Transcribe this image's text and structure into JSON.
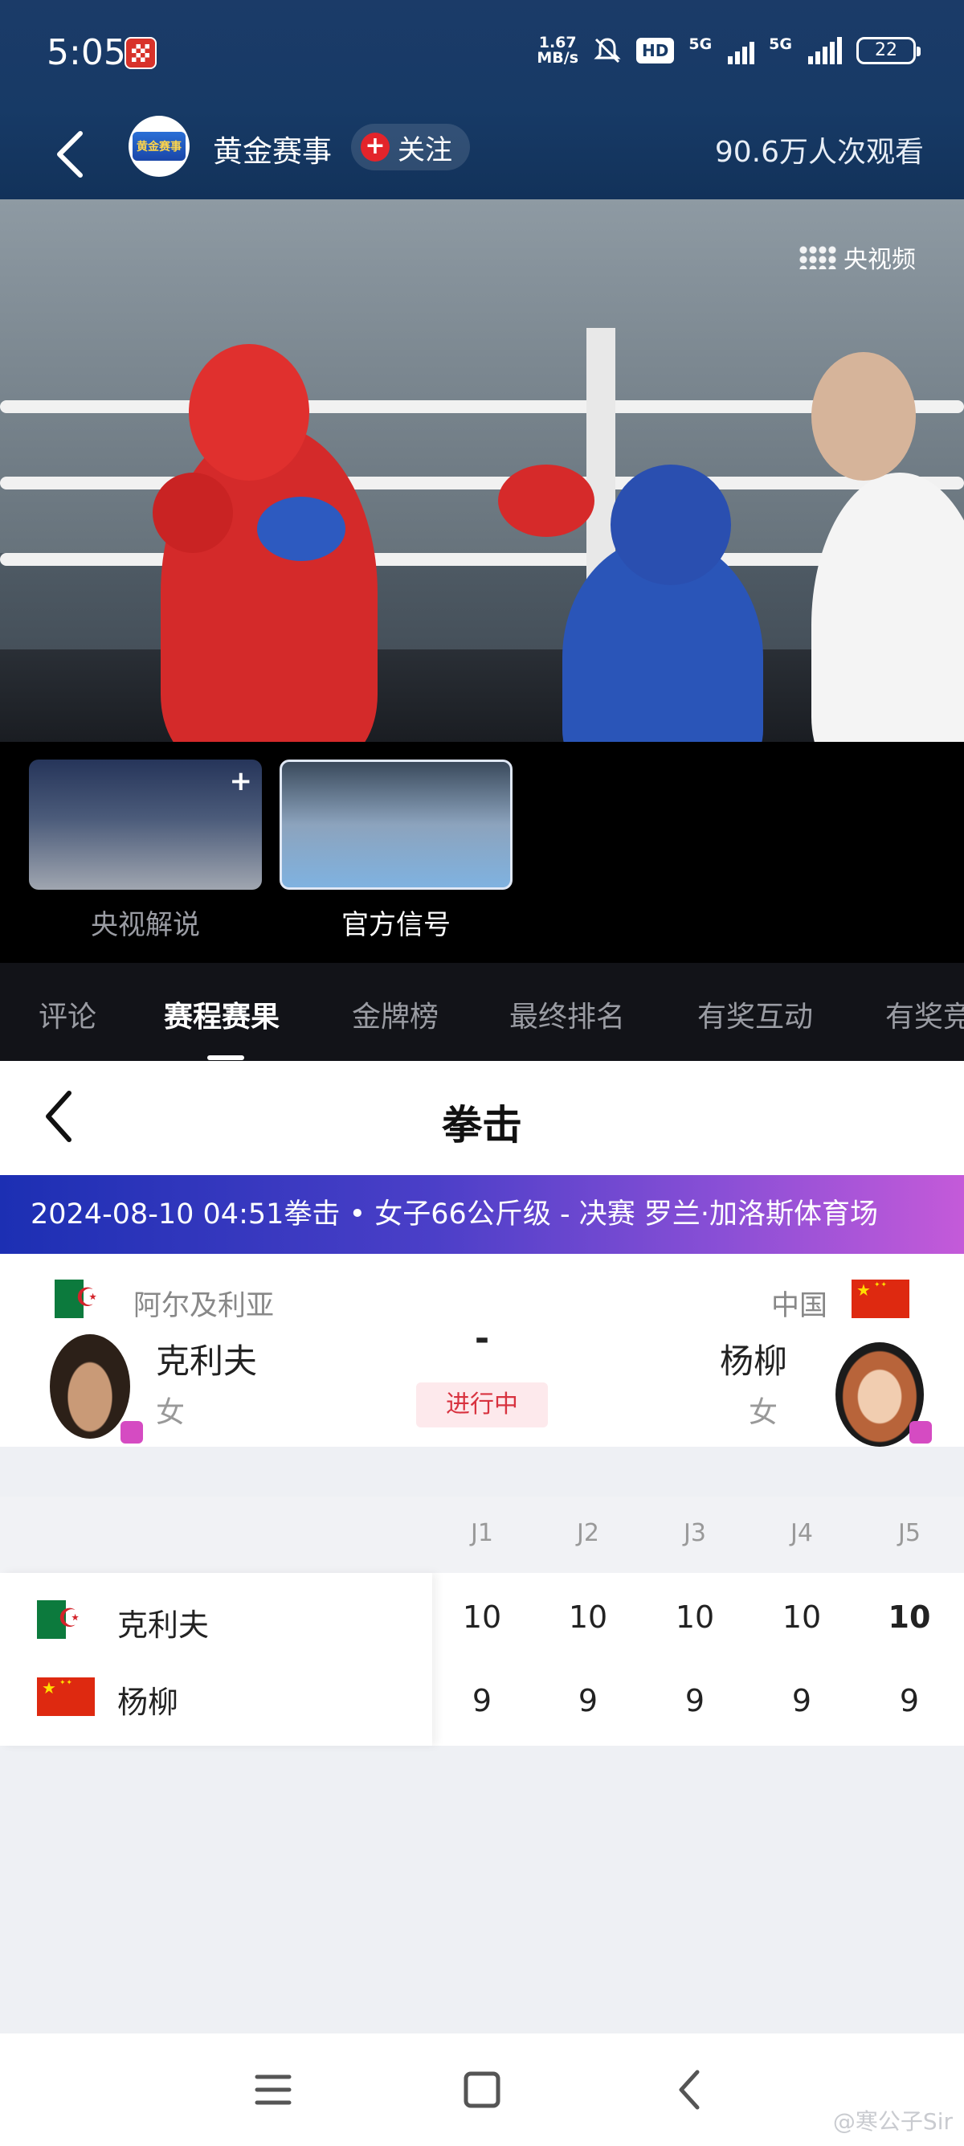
{
  "status_bar": {
    "time": "5:05",
    "net_speed_value": "1.67",
    "net_speed_unit": "MB/s",
    "hd_label": "HD",
    "sim1_label": "5G",
    "sim2_label": "5G",
    "battery": "22"
  },
  "header": {
    "channel_logo_text": "黄金赛事",
    "channel_name": "黄金赛事",
    "follow_label": "关注",
    "viewers": "90.6万人次观看"
  },
  "video": {
    "watermark": "央视频"
  },
  "cameras": [
    {
      "label": "央视解说",
      "selected": false
    },
    {
      "label": "官方信号",
      "selected": true
    }
  ],
  "tabs": [
    {
      "label": "评论",
      "active": false
    },
    {
      "label": "赛程赛果",
      "active": true
    },
    {
      "label": "金牌榜",
      "active": false
    },
    {
      "label": "最终排名",
      "active": false
    },
    {
      "label": "有奖互动",
      "active": false
    },
    {
      "label": "有奖竞",
      "active": false
    }
  ],
  "sport_panel": {
    "title": "拳击",
    "event_banner": "2024-08-10 04:51拳击 • 女子66公斤级 - 决赛 罗兰·加洛斯体育场",
    "score_placeholder": "-",
    "status": "进行中",
    "left_fighter": {
      "country": "阿尔及利亚",
      "name": "克利夫",
      "gender": "女"
    },
    "right_fighter": {
      "country": "中国",
      "name": "杨柳",
      "gender": "女"
    }
  },
  "score_table": {
    "judges": [
      "J1",
      "J2",
      "J3",
      "J4",
      "J5"
    ],
    "rows": [
      {
        "name": "克利夫",
        "scores": [
          "10",
          "10",
          "10",
          "10",
          "10"
        ]
      },
      {
        "name": "杨柳",
        "scores": [
          "9",
          "9",
          "9",
          "9",
          "9"
        ]
      }
    ]
  },
  "watermark_footer": "@寒公子Sir",
  "colors": {
    "header_bg": "#173a66",
    "live_red": "#d8323f",
    "banner_start": "#1c2fb3",
    "banner_end": "#c45ad9"
  }
}
